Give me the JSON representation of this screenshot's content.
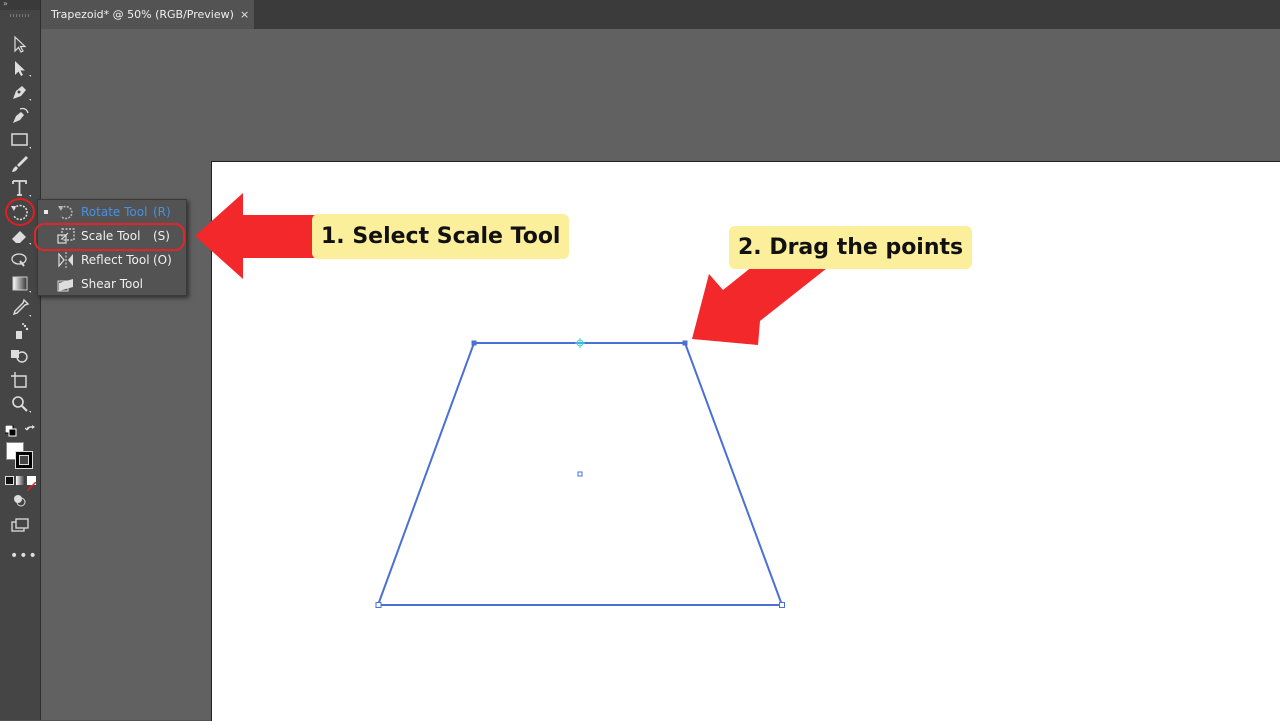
{
  "document": {
    "tab_title": "Trapezoid* @ 50% (RGB/Preview)",
    "tab_close": "×"
  },
  "toolbar": {
    "header": "»",
    "more": "•••",
    "tools": [
      {
        "name": "selection-tool",
        "icon": "selection-arrow-icon"
      },
      {
        "name": "direct-selection-tool",
        "icon": "direct-selection-arrow-icon"
      },
      {
        "name": "pen-tool",
        "icon": "pen-icon"
      },
      {
        "name": "curvature-tool",
        "icon": "curvature-pen-icon"
      },
      {
        "name": "rectangle-tool",
        "icon": "rectangle-icon"
      },
      {
        "name": "paintbrush-tool",
        "icon": "paintbrush-icon"
      },
      {
        "name": "type-tool",
        "icon": "type-icon"
      },
      {
        "name": "rotate-tool",
        "icon": "rotate-icon",
        "active": true
      },
      {
        "name": "eraser-tool",
        "icon": "eraser-icon"
      },
      {
        "name": "puppet-warp-tool",
        "icon": "warp-icon"
      },
      {
        "name": "gradient-tool",
        "icon": "gradient-icon"
      },
      {
        "name": "eyedropper-tool",
        "icon": "eyedropper-icon"
      },
      {
        "name": "symbol-sprayer-tool",
        "icon": "sprayer-icon"
      },
      {
        "name": "shape-builder-tool",
        "icon": "shape-builder-icon"
      },
      {
        "name": "artboard-tool",
        "icon": "artboard-icon"
      },
      {
        "name": "zoom-tool",
        "icon": "zoom-icon"
      }
    ]
  },
  "flyout": {
    "items": [
      {
        "label": "Rotate Tool",
        "shortcut": "(R)",
        "icon": "rotate-icon",
        "current": true
      },
      {
        "label": "Scale Tool",
        "shortcut": "(S)",
        "icon": "scale-icon",
        "current": false
      },
      {
        "label": "Reflect Tool",
        "shortcut": "(O)",
        "icon": "reflect-icon",
        "current": false
      },
      {
        "label": "Shear Tool",
        "shortcut": "",
        "icon": "shear-icon",
        "current": false
      }
    ]
  },
  "annotations": {
    "step1": "1. Select Scale Tool",
    "step2": "2. Drag the points",
    "arrow_color": "#f2282a",
    "callout_color": "#fbef9b"
  },
  "shape": {
    "name": "Trapezoid",
    "stroke_color": "#4a6fd6"
  }
}
